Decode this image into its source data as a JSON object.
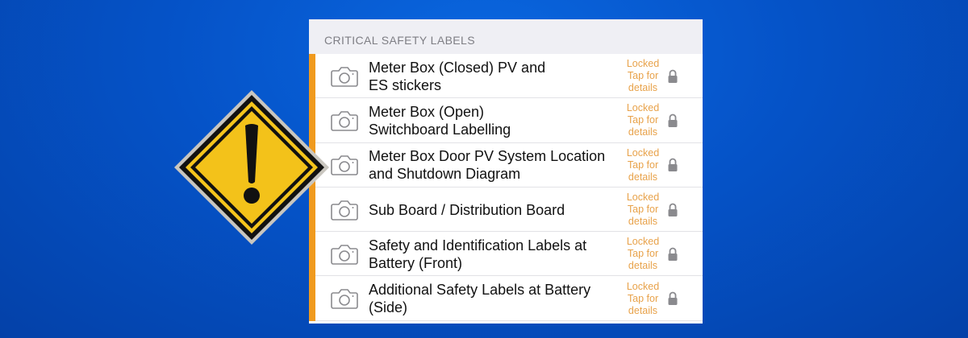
{
  "section": {
    "header": "CRITICAL SAFETY LABELS"
  },
  "colors": {
    "accent": "#f09a1e",
    "status_text": "#e8a24a",
    "background": "#0553c8",
    "sign_yellow": "#f5c51c"
  },
  "icons": {
    "row_icon": "camera-icon",
    "status_icon": "lock-icon",
    "decoration": "warning-sign-icon"
  },
  "items": [
    {
      "title_line1": "Meter Box (Closed) PV and",
      "title_line2": "ES stickers",
      "status1": "Locked",
      "status2": "Tap for",
      "status3": "details"
    },
    {
      "title_line1": "Meter Box (Open)",
      "title_line2": "Switchboard Labelling",
      "status1": "Locked",
      "status2": "Tap for",
      "status3": "details"
    },
    {
      "title_line1": "Meter Box Door PV System Location",
      "title_line2": "and Shutdown Diagram",
      "status1": "Locked",
      "status2": "Tap for",
      "status3": "details"
    },
    {
      "title_line1": "Sub Board / Distribution Board",
      "title_line2": "",
      "status1": "Locked",
      "status2": "Tap for",
      "status3": "details"
    },
    {
      "title_line1": "Safety and Identification Labels at",
      "title_line2": "Battery (Front)",
      "status1": "Locked",
      "status2": "Tap for",
      "status3": "details"
    },
    {
      "title_line1": "Additional Safety Labels at Battery",
      "title_line2": "(Side)",
      "status1": "Locked",
      "status2": "Tap for",
      "status3": "details"
    }
  ]
}
